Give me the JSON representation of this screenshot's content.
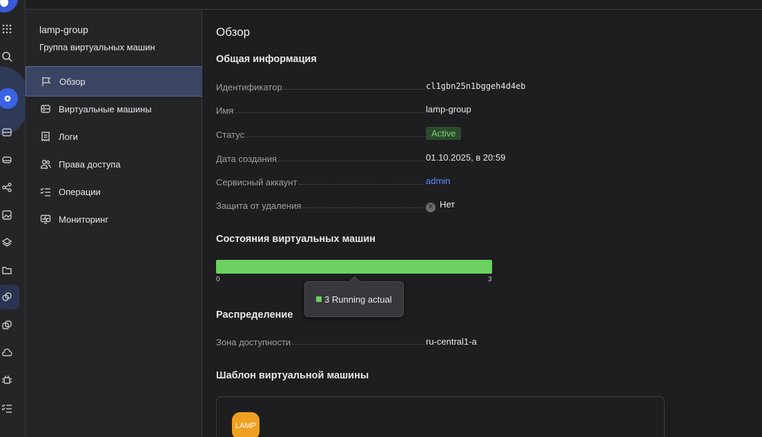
{
  "rail": {
    "icons": [
      "apps-icon",
      "search-icon",
      "settings-icon",
      "server-icon",
      "disk-icon",
      "network-icon",
      "image-icon",
      "layers-icon",
      "folder-icon",
      "instance-group-icon",
      "snapshot-icon",
      "cloud-icon",
      "chip-icon",
      "list-icon"
    ]
  },
  "sidebar": {
    "title": "lamp-group",
    "subtitle": "Группа виртуальных машин",
    "items": [
      {
        "label": "Обзор",
        "icon": "flag-icon",
        "active": true
      },
      {
        "label": "Виртуальные машины",
        "icon": "server-icon",
        "active": false
      },
      {
        "label": "Логи",
        "icon": "log-icon",
        "active": false
      },
      {
        "label": "Права доступа",
        "icon": "users-icon",
        "active": false
      },
      {
        "label": "Операции",
        "icon": "checklist-icon",
        "active": false
      },
      {
        "label": "Мониторинг",
        "icon": "monitor-icon",
        "active": false
      }
    ]
  },
  "main": {
    "page_title": "Обзор",
    "general": {
      "title": "Общая информация",
      "id_label": "Идентификатор",
      "id_value": "cl1gbn25n1bggeh4d4eb",
      "name_label": "Имя",
      "name_value": "lamp-group",
      "status_label": "Статус",
      "status_value": "Active",
      "created_label": "Дата создания",
      "created_value": "01.10.2025, в 20:59",
      "account_label": "Сервисный аккаунт",
      "account_value": "admin",
      "protection_label": "Защита от удаления",
      "protection_value": "Нет"
    },
    "states": {
      "title": "Состояния виртуальных машин",
      "min_label": "0",
      "max_label": "3",
      "running_fraction": 1.0,
      "tooltip_count": "3",
      "tooltip_text": "Running actual",
      "bar_color": "#6cd160"
    },
    "distribution": {
      "title": "Распределение",
      "zone_label": "Зона доступности",
      "zone_value": "ru-central1-a"
    },
    "template": {
      "title": "Шаблон виртуальной машины",
      "logo_text": "LAMP"
    }
  },
  "colors": {
    "accent": "#3a63e6",
    "link": "#5a8cff",
    "active_badge_bg": "#2d4a2d",
    "active_badge_fg": "#7fcf6f",
    "lamp": "#f0a020"
  }
}
